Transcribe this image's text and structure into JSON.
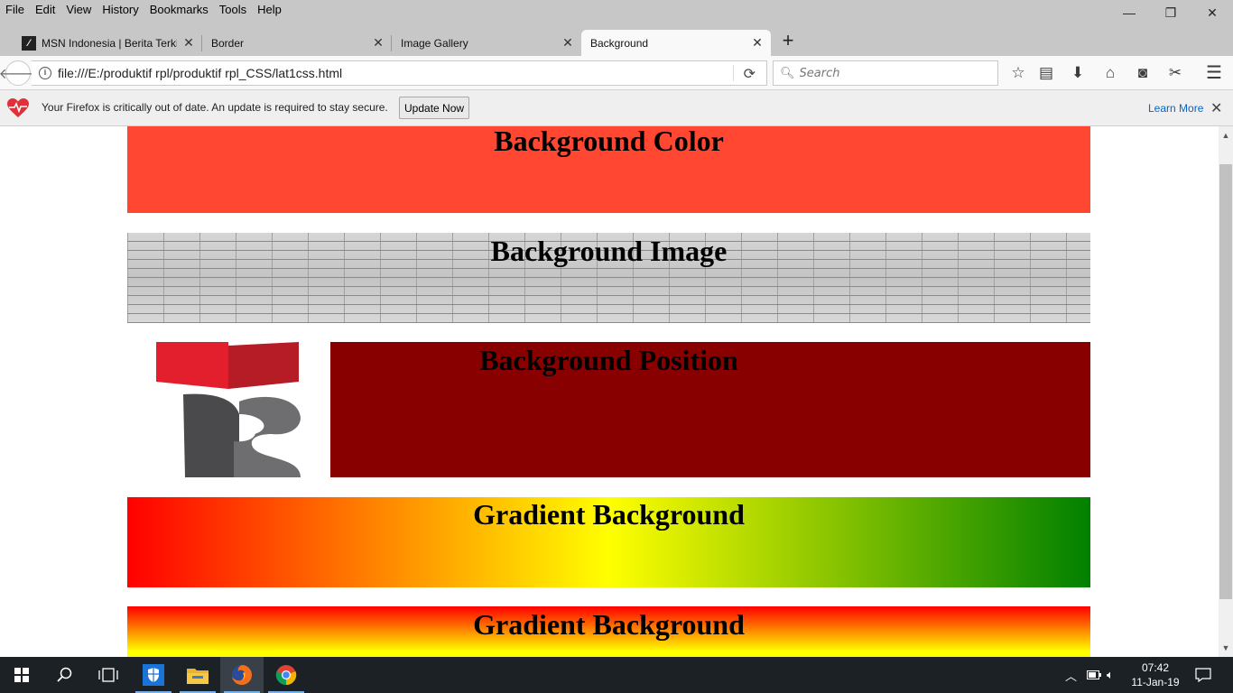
{
  "menu": [
    "File",
    "Edit",
    "View",
    "History",
    "Bookmarks",
    "Tools",
    "Help"
  ],
  "window_controls": {
    "minimize": "—",
    "restore": "❐",
    "close": "✕"
  },
  "tabs": [
    {
      "label": "MSN Indonesia | Berita Terki",
      "active": false
    },
    {
      "label": "Border",
      "active": false
    },
    {
      "label": "Image Gallery",
      "active": false
    },
    {
      "label": "Background",
      "active": true
    }
  ],
  "newtab_label": "+",
  "urlbar": {
    "url": "file:///E:/produktif rpl/produktif rpl_CSS/lat1css.html"
  },
  "searchbar": {
    "placeholder": "Search"
  },
  "notification": {
    "message": "Your Firefox is critically out of date. An update is required to stay secure.",
    "button": "Update Now",
    "link": "Learn More"
  },
  "page": {
    "sections": [
      "Background Color",
      "Background Image",
      "Background Position",
      "Gradient Background",
      "Gradient Background"
    ]
  },
  "colors": {
    "bg_color_box": "#ff4732",
    "bg_position_box": "#880000",
    "gradient1": [
      "#ff0000",
      "#ffff00",
      "#008000"
    ],
    "gradient2": [
      "#ff0000",
      "#ffff00"
    ]
  },
  "taskbar": {
    "clock_time": "07:42",
    "clock_date": "11-Jan-19"
  }
}
